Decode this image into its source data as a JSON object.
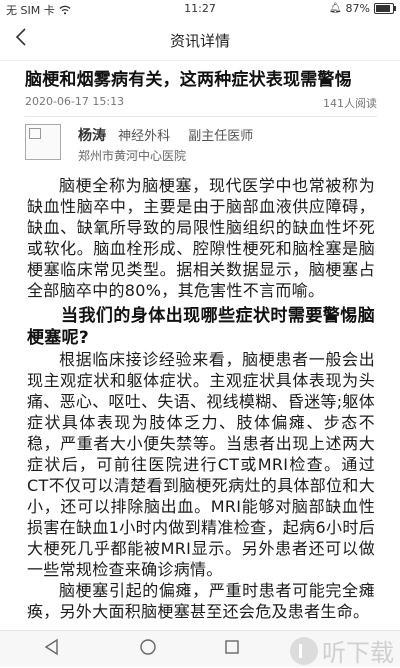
{
  "status_bar": {
    "carrier": "无 SIM 卡",
    "time": "11:27",
    "battery_text": "87%",
    "battery_level": 0.87
  },
  "nav": {
    "title": "资讯详情"
  },
  "article": {
    "title": "脑梗和烟雾病有关，这两种症状表现需警惕",
    "date": "2020-06-17 15:13",
    "reads": "141人阅读",
    "doctor": {
      "name": "杨涛",
      "department": "神经外科",
      "title": "副主任医师",
      "hospital": "郑州市黄河中心医院"
    },
    "paragraph_1": "脑梗全称为脑梗塞，现代医学中也常被称为缺血性脑卒中，主要是由于脑部血液供应障碍，缺血、缺氧所导致的局限性脑组织的缺血性坏死或软化。脑血栓形成、腔隙性梗死和脑栓塞是脑梗塞临床常见类型。据相关数据显示，脑梗塞占全部脑卒中的80%，其危害性不言而喻。",
    "subheading": "当我们的身体出现哪些症状时需要警惕脑梗塞呢?",
    "paragraph_2": "根据临床接诊经验来看，脑梗患者一般会出现主观症状和躯体症状。主观症状具体表现为头痛、恶心、呕吐、失语、视线模糊、昏迷等;躯体症状具体表现为肢体乏力、肢体偏瘫、步态不稳，严重者大小便失禁等。当患者出现上述两大症状后，可前往医院进行CT或MRI检查。通过CT不仅可以清楚看到脑梗死病灶的具体部位和大小，还可以排除脑出血。MRI能够对脑部缺血性损害在缺血1小时内做到精准检查，起病6小时后大梗死几乎都能被MRI显示。另外患者还可以做一些常规检查来确诊病情。",
    "paragraph_3": "脑梗塞引起的偏瘫，严重时患者可能完全瘫痪，另外大面积脑梗塞甚至还会危及患者生命。"
  },
  "watermark": {
    "text": "听下载"
  },
  "icons": {
    "back": "back-chevron-icon",
    "wifi": "wifi-icon",
    "battery": "battery-icon",
    "nav_back": "triangle-back-icon",
    "nav_home": "circle-home-icon",
    "nav_recent": "square-recent-icon"
  }
}
